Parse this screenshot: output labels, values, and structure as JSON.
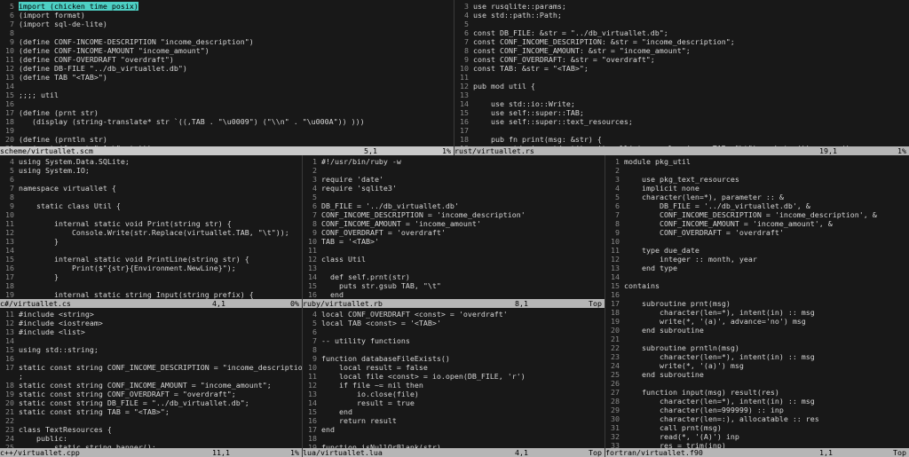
{
  "panes": [
    {
      "id": "scheme",
      "status": {
        "file": "scheme/virtuallet.scm",
        "pos": "5,1",
        "pct": "1%"
      },
      "lines": [
        [
          "5",
          "import (chicken time posix)"
        ],
        [
          "6",
          "(import format)"
        ],
        [
          "7",
          "(import sql-de-lite)"
        ],
        [
          "8",
          ""
        ],
        [
          "9",
          "(define CONF-INCOME-DESCRIPTION \"income_description\")"
        ],
        [
          "10",
          "(define CONF-INCOME-AMOUNT \"income_amount\")"
        ],
        [
          "11",
          "(define CONF-OVERDRAFT \"overdraft\")"
        ],
        [
          "12",
          "(define DB-FILE \"../db_virtuallet.db\")"
        ],
        [
          "13",
          "(define TAB \"<TAB>\")"
        ],
        [
          "14",
          ""
        ],
        [
          "15",
          ";;;; util"
        ],
        [
          "16",
          ""
        ],
        [
          "17",
          "(define (prnt str)"
        ],
        [
          "18",
          "   (display (string-translate* str `((,TAB . \"\\u0009\") (\"\\\\n\" . \"\\u000A\")) )))"
        ],
        [
          "19",
          ""
        ],
        [
          "20",
          "(define (prntln str)"
        ],
        [
          "21",
          "   (prnt (format \"~A~%\" str)))"
        ]
      ]
    },
    {
      "id": "rust",
      "status": {
        "file": "rust/virtuallet.rs",
        "pos": "19,1",
        "pct": "1%"
      },
      "lines": [
        [
          "3",
          "use rusqlite::params;"
        ],
        [
          "4",
          "use std::path::Path;"
        ],
        [
          "5",
          ""
        ],
        [
          "6",
          "const DB_FILE: &str = \"../db_virtuallet.db\";"
        ],
        [
          "7",
          "const CONF_INCOME_DESCRIPTION: &str = \"income_description\";"
        ],
        [
          "8",
          "const CONF_INCOME_AMOUNT: &str = \"income_amount\";"
        ],
        [
          "9",
          "const CONF_OVERDRAFT: &str = \"overdraft\";"
        ],
        [
          "10",
          "const TAB: &str = \"<TAB>\";"
        ],
        [
          "11",
          ""
        ],
        [
          "12",
          "pub mod util {"
        ],
        [
          "13",
          ""
        ],
        [
          "14",
          "    use std::io::Write;"
        ],
        [
          "15",
          "    use self::super::TAB;"
        ],
        [
          "16",
          "    use self::super::text_resources;"
        ],
        [
          "17",
          ""
        ],
        [
          "18",
          "    pub fn print(msg: &str) {"
        ],
        [
          "19",
          "        std::io::stdout().write_all(str::replace(msg, TAB, \"\\t\").as_bytes()).unwrap();"
        ]
      ]
    },
    {
      "id": "csharp",
      "status": {
        "file": "c#/virtuallet.cs",
        "pos": "4,1",
        "pct": "0%"
      },
      "lines": [
        [
          "4",
          "using System.Data.SQLite;"
        ],
        [
          "5",
          "using System.IO;"
        ],
        [
          "6",
          ""
        ],
        [
          "7",
          "namespace virtuallet {"
        ],
        [
          "8",
          ""
        ],
        [
          "9",
          "    static class Util {"
        ],
        [
          "10",
          ""
        ],
        [
          "11",
          "        internal static void Print(string str) {"
        ],
        [
          "12",
          "            Console.Write(str.Replace(virtuallet.TAB, \"\\t\"));"
        ],
        [
          "13",
          "        }"
        ],
        [
          "14",
          ""
        ],
        [
          "15",
          "        internal static void PrintLine(string str) {"
        ],
        [
          "16",
          "            Print($\"{str}{Environment.NewLine}\");"
        ],
        [
          "17",
          "        }"
        ],
        [
          "18",
          ""
        ],
        [
          "19",
          "        internal static string Input(string prefix) {"
        ],
        [
          "20",
          "            Print(prefix);"
        ]
      ]
    },
    {
      "id": "cpp",
      "status": {
        "file": "c++/virtuallet.cpp",
        "pos": "11,1",
        "pct": "1%"
      },
      "lines": [
        [
          "11",
          "#include <string>"
        ],
        [
          "12",
          "#include <iostream>"
        ],
        [
          "13",
          "#include <list>"
        ],
        [
          "14",
          ""
        ],
        [
          "15",
          "using std::string;"
        ],
        [
          "16",
          ""
        ],
        [
          "17",
          "static const string CONF_INCOME_DESCRIPTION = \"income_description\""
        ],
        [
          "",
          ";"
        ],
        [
          "18",
          "static const string CONF_INCOME_AMOUNT = \"income_amount\";"
        ],
        [
          "19",
          "static const string CONF_OVERDRAFT = \"overdraft\";"
        ],
        [
          "20",
          "static const string DB_FILE = \"../db_virtuallet.db\";"
        ],
        [
          "21",
          "static const string TAB = \"<TAB>\";"
        ],
        [
          "22",
          ""
        ],
        [
          "23",
          "class TextResources {"
        ],
        [
          "24",
          "    public:"
        ],
        [
          "25",
          "        static string banner();"
        ]
      ]
    },
    {
      "id": "ruby",
      "status": {
        "file": "ruby/virtuallet.rb",
        "pos": "8,1",
        "pct": "Top"
      },
      "lines": [
        [
          "1",
          "#!/usr/bin/ruby -w"
        ],
        [
          "2",
          ""
        ],
        [
          "3",
          "require 'date'"
        ],
        [
          "4",
          "require 'sqlite3'"
        ],
        [
          "5",
          ""
        ],
        [
          "6",
          "DB_FILE = '../db_virtuallet.db'"
        ],
        [
          "7",
          "CONF_INCOME_DESCRIPTION = 'income_description'"
        ],
        [
          "8",
          "CONF_INCOME_AMOUNT = 'income_amount'"
        ],
        [
          "9",
          "CONF_OVERDRAFT = 'overdraft'"
        ],
        [
          "10",
          "TAB = '<TAB>'"
        ],
        [
          "11",
          ""
        ],
        [
          "12",
          "class Util"
        ],
        [
          "13",
          ""
        ],
        [
          "14",
          "  def self.prnt(str)"
        ],
        [
          "15",
          "    puts str.gsub TAB, \"\\t\""
        ],
        [
          "16",
          "  end"
        ]
      ]
    },
    {
      "id": "lua",
      "status": {
        "file": "lua/virtuallet.lua",
        "pos": "4,1",
        "pct": "Top"
      },
      "lines": [
        [
          "4",
          "local CONF_OVERDRAFT <const> = 'overdraft'"
        ],
        [
          "5",
          "local TAB <const> = '<TAB>'"
        ],
        [
          "6",
          ""
        ],
        [
          "7",
          "-- utility functions"
        ],
        [
          "8",
          ""
        ],
        [
          "9",
          "function databaseFileExists()"
        ],
        [
          "10",
          "    local result = false"
        ],
        [
          "11",
          "    local file <const> = io.open(DB_FILE, 'r')"
        ],
        [
          "12",
          "    if file ~= nil then"
        ],
        [
          "13",
          "        io.close(file)"
        ],
        [
          "14",
          "        result = true"
        ],
        [
          "15",
          "    end"
        ],
        [
          "16",
          "    return result"
        ],
        [
          "17",
          "end"
        ],
        [
          "18",
          ""
        ],
        [
          "19",
          "function isNullOrBlank(str)"
        ]
      ]
    },
    {
      "id": "fortran",
      "status": {
        "file": "fortran/virtuallet.f90",
        "pos": "1,1",
        "pct": "Top"
      },
      "lines": [
        [
          "1",
          "module pkg_util"
        ],
        [
          "2",
          ""
        ],
        [
          "3",
          "    use pkg_text_resources"
        ],
        [
          "4",
          "    implicit none"
        ],
        [
          "5",
          "    character(len=*), parameter :: &"
        ],
        [
          "6",
          "        DB_FILE = '../db_virtuallet.db', &"
        ],
        [
          "7",
          "        CONF_INCOME_DESCRIPTION = 'income_description', &"
        ],
        [
          "8",
          "        CONF_INCOME_AMOUNT = 'income_amount', &"
        ],
        [
          "9",
          "        CONF_OVERDRAFT = 'overdraft'"
        ],
        [
          "10",
          ""
        ],
        [
          "11",
          "    type due_date"
        ],
        [
          "12",
          "        integer :: month, year"
        ],
        [
          "13",
          "    end type"
        ],
        [
          "14",
          ""
        ],
        [
          "15",
          "contains"
        ],
        [
          "16",
          ""
        ],
        [
          "17",
          "    subroutine prnt(msg)"
        ],
        [
          "18",
          "        character(len=*), intent(in) :: msg"
        ],
        [
          "19",
          "        write(*, '(a)', advance='no') msg"
        ],
        [
          "20",
          "    end subroutine"
        ],
        [
          "21",
          ""
        ],
        [
          "22",
          "    subroutine prntln(msg)"
        ],
        [
          "23",
          "        character(len=*), intent(in) :: msg"
        ],
        [
          "24",
          "        write(*, '(a)') msg"
        ],
        [
          "25",
          "    end subroutine"
        ],
        [
          "26",
          ""
        ],
        [
          "27",
          "    function input(msg) result(res)"
        ],
        [
          "28",
          "        character(len=*), intent(in) :: msg"
        ],
        [
          "29",
          "        character(len=999999) :: inp"
        ],
        [
          "30",
          "        character(len=:), allocatable :: res"
        ],
        [
          "31",
          "        call prnt(msg)"
        ],
        [
          "32",
          "        read(*, '(A)') inp"
        ],
        [
          "33",
          "        res = trim(inp)"
        ],
        [
          "34",
          "    end function input"
        ]
      ]
    }
  ]
}
